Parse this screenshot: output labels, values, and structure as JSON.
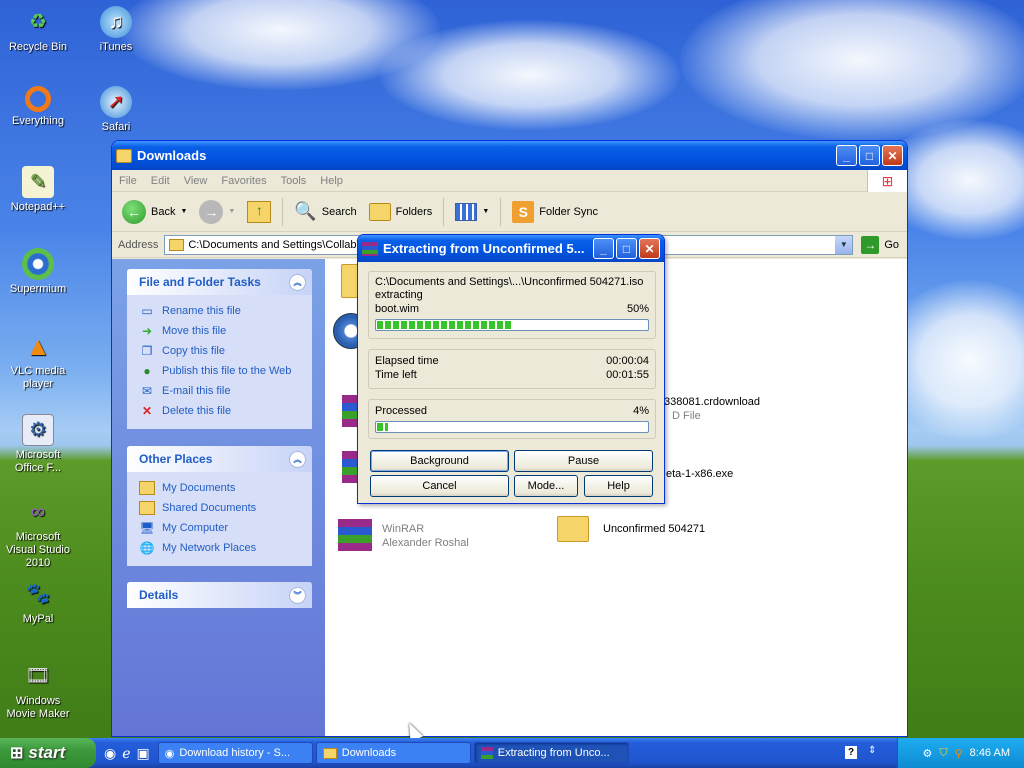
{
  "desktop": {
    "icons": [
      {
        "label": "Recycle Bin",
        "icon": "recycle-bin-icon"
      },
      {
        "label": "iTunes",
        "icon": "itunes-icon"
      },
      {
        "label": "Everything",
        "icon": "everything-icon"
      },
      {
        "label": "Safari",
        "icon": "safari-icon"
      },
      {
        "label": "Notepad++",
        "icon": "notepad-plus-plus-icon"
      },
      {
        "label": "Supermium",
        "icon": "supermium-icon"
      },
      {
        "label": "VLC media player",
        "icon": "vlc-icon"
      },
      {
        "label": "Microsoft Office F...",
        "icon": "office-icon"
      },
      {
        "label": "Microsoft Visual Studio 2010",
        "icon": "visual-studio-icon"
      },
      {
        "label": "MyPal",
        "icon": "mypal-icon"
      },
      {
        "label": "Windows Movie Maker",
        "icon": "movie-maker-icon"
      }
    ]
  },
  "explorer": {
    "title": "Downloads",
    "menu": [
      "File",
      "Edit",
      "View",
      "Favorites",
      "Tools",
      "Help"
    ],
    "toolbar": {
      "back": "Back",
      "search": "Search",
      "folders": "Folders",
      "folder_sync": "Folder Sync"
    },
    "address": {
      "label": "Address",
      "value": "C:\\Documents and Settings\\CollabVM",
      "go": "Go"
    },
    "file_tasks": {
      "title": "File and Folder Tasks",
      "items": [
        "Rename this file",
        "Move this file",
        "Copy this file",
        "Publish this file to the Web",
        "E-mail this file",
        "Delete this file"
      ]
    },
    "other_places": {
      "title": "Other Places",
      "items": [
        "My Documents",
        "Shared Documents",
        "My Computer",
        "My Network Places"
      ]
    },
    "details": {
      "title": "Details"
    },
    "files": {
      "f1_name": "338081.crdownload",
      "f1_type": "D File",
      "f2_name": "eta-1-x86.exe",
      "f3_name": "WinRAR",
      "f3_sub": "Alexander Roshal",
      "f4_name": "Unconfirmed 504271"
    }
  },
  "dialog": {
    "title": "Extracting from Unconfirmed 5...",
    "path": "C:\\Documents and Settings\\...\\Unconfirmed 504271.iso",
    "action": "extracting",
    "file": "boot.wim",
    "file_percent": "50%",
    "file_progress": 0.5,
    "elapsed_label": "Elapsed time",
    "elapsed_value": "00:00:04",
    "left_label": "Time left",
    "left_value": "00:01:55",
    "processed_label": "Processed",
    "processed_percent": "4%",
    "processed_progress": 0.04,
    "buttons": {
      "background": "Background",
      "pause": "Pause",
      "cancel": "Cancel",
      "mode": "Mode...",
      "help": "Help"
    }
  },
  "taskbar": {
    "start": "start",
    "tasks": [
      "Download history - S...",
      "Downloads",
      "Extracting from Unco..."
    ],
    "clock": "8:46 AM"
  }
}
